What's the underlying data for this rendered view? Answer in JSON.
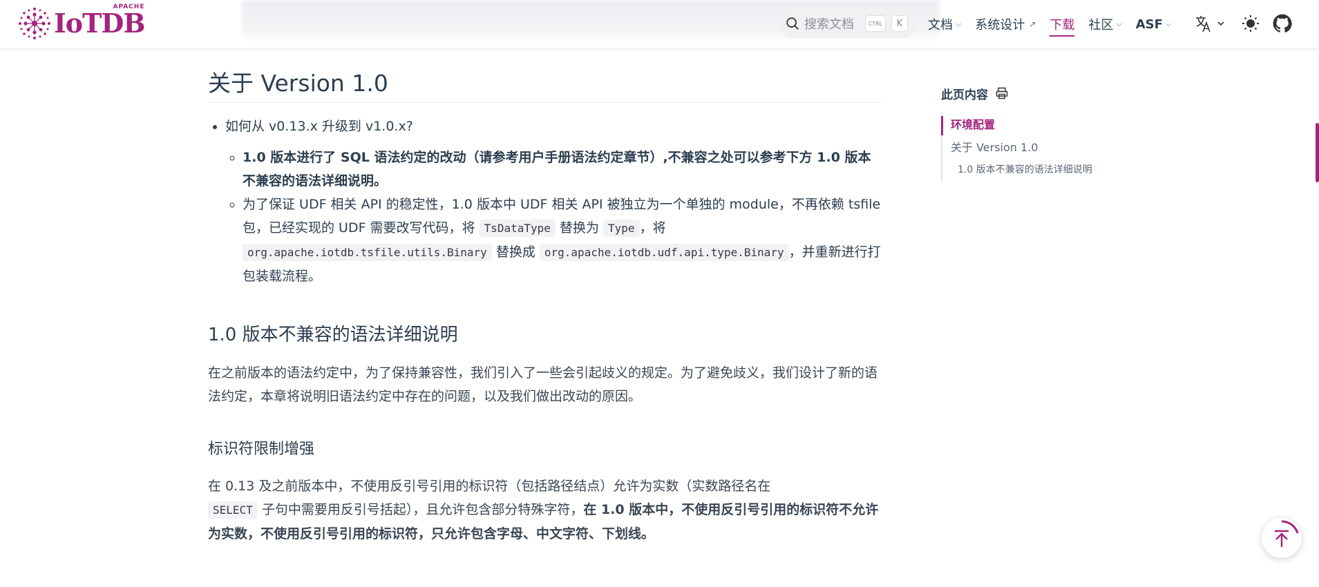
{
  "navbar": {
    "logo_text": "IoTDB",
    "logo_small": "APACHE",
    "search_placeholder": "搜索文档",
    "search_key_ctrl": "CTRL",
    "search_key_k": "K",
    "links": [
      {
        "label": "文档",
        "caret": true
      },
      {
        "label": "系统设计",
        "external": true
      },
      {
        "label": "下载",
        "active": true
      },
      {
        "label": "社区",
        "caret": true
      },
      {
        "label": "ASF",
        "caret": true
      }
    ],
    "icons": [
      "translate-icon",
      "theme-toggle-icon",
      "github-icon"
    ]
  },
  "content": {
    "title": "关于 Version 1.0",
    "bullet": "如何从 v0.13.x 升级到 v1.0.x?",
    "sub1": "1.0 版本进行了 SQL 语法约定的改动（请参考用户手册语法约定章节）,不兼容之处可以参考下方 1.0 版本不兼容的语法详细说明。",
    "sub2": {
      "t1": "为了保证 UDF 相关 API 的稳定性，1.0 版本中 UDF 相关 API 被独立为一个单独的 module，不再依赖 tsfile 包，已经实现的 UDF 需要改写代码，将",
      "c1": "TsDataType",
      "t2": "替换为",
      "c2": "Type",
      "t3": "，将",
      "c3": "org.apache.iotdb.tsfile.utils.Binary",
      "t4": "替换成",
      "c4": "org.apache.iotdb.udf.api.type.Binary",
      "t5": "，并重新进行打包装载流程。"
    },
    "h2": "1.0 版本不兼容的语法详细说明",
    "para": "在之前版本的语法约定中，为了保持兼容性，我们引入了一些会引起歧义的规定。为了避免歧义，我们设计了新的语法约定，本章将说明旧语法约定中存在的问题，以及我们做出改动的原因。",
    "h3": "标识符限制增强",
    "para2": {
      "t1": "在 0.13 及之前版本中，不使用反引号引用的标识符（包括路径结点）允许为实数（实数路径名在",
      "c1": "SELECT",
      "t2": "子句中需要用反引号括起），且允许包含部分特殊字符，",
      "b1": "在 1.0 版本中，不使用反引号引用的标识符不允许为实数，不使用反引号引用的标识符，只允许包含字母、中文字符、下划线。"
    }
  },
  "toc": {
    "title": "此页内容",
    "items": [
      {
        "label": "环境配置",
        "active": true
      },
      {
        "label": "关于 Version 1.0"
      },
      {
        "label": "1.0 版本不兼容的语法详细说明",
        "level": 2
      }
    ]
  },
  "colors": {
    "brand": "#a3247d",
    "text": "#2c3e50",
    "code_bg": "#f1f2f4"
  }
}
